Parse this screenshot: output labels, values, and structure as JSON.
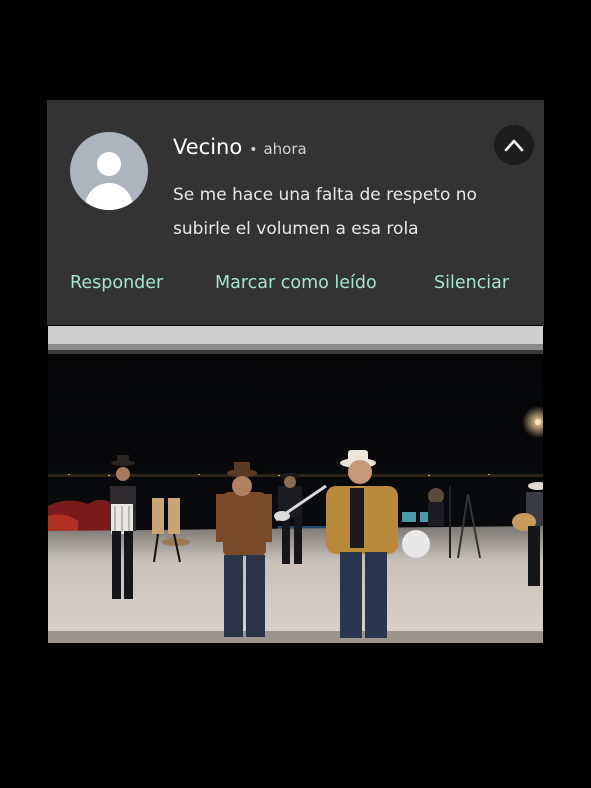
{
  "notification": {
    "sender": "Vecino",
    "separator": "•",
    "time": "ahora",
    "message": "Se me hace una falta de respeto no subirle el volumen a esa rola",
    "actions": [
      {
        "label": "Responder"
      },
      {
        "label": "Marcar como leído"
      },
      {
        "label": "Silenciar"
      }
    ],
    "colors": {
      "background": "#333333",
      "action_text": "#a6e3cf",
      "avatar": "#aeb4bd"
    }
  },
  "icons": {
    "avatar": "person-icon",
    "collapse": "chevron-up-icon"
  }
}
